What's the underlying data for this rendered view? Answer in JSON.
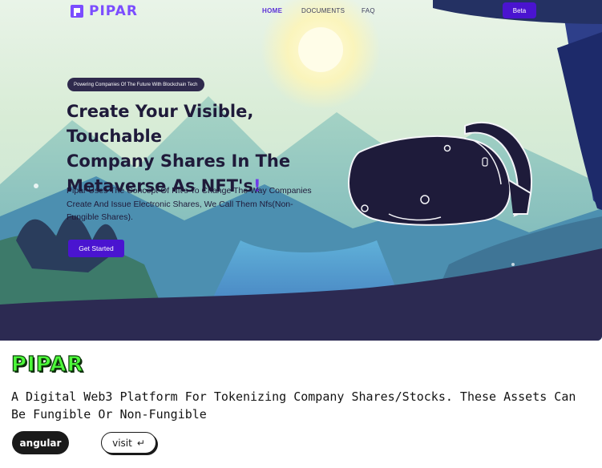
{
  "header": {
    "logo_text": "PIPAR",
    "nav": [
      {
        "label": "HOME",
        "active": true
      },
      {
        "label": "DOCUMENTS",
        "active": false
      },
      {
        "label": "FAQ",
        "active": false
      }
    ],
    "beta_label": "Beta"
  },
  "hero": {
    "pill_text": "Powering Companies Of The Future With Blockchain Tech",
    "headline_line1": "Create Your Visible, Touchable",
    "headline_line2": "Company Shares In The",
    "headline_line3": "Metaverse As NFT's",
    "headline_bang": "!",
    "description": "Pipar Uses The Concept Of Nft's To Change The Way Companies Create And Issue Electronic Shares, We Call Them Nfs(Non-Fungible Shares).",
    "cta_label": "Get Started"
  },
  "card": {
    "brand": "PIPAR",
    "tagline": "A Digital Web3 Platform For Tokenizing Company Shares/Stocks. These Assets Can Be Fungible Or Non-Fungible",
    "tech_tag": "angular",
    "visit_label": "visit",
    "visit_icon": "return-arrow-icon"
  },
  "colors": {
    "accent": "#4a14d0",
    "logo": "#7b4dff",
    "brand_green": "#4dfa3a",
    "dark": "#1f1a3a"
  }
}
